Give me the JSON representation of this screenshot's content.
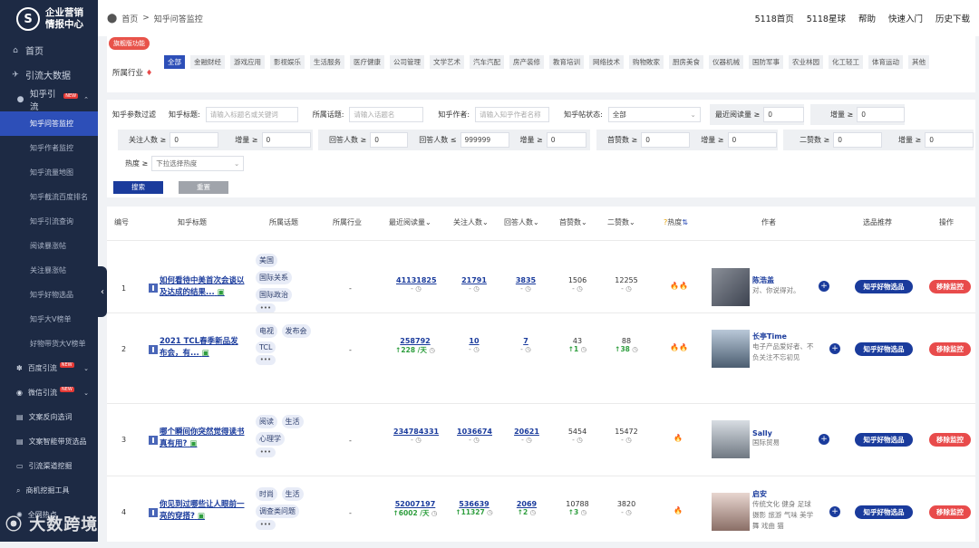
{
  "logo": {
    "line1": "企业营销",
    "line2": "情报中心"
  },
  "sidebar": {
    "top_items": [
      {
        "label": "首页"
      },
      {
        "label": "引流大数据"
      }
    ],
    "zhihu": {
      "label": "知乎引流",
      "badge": "NEW"
    },
    "zhihu_sub": [
      {
        "label": "知乎问答监控",
        "active": true
      },
      {
        "label": "知乎作者监控"
      },
      {
        "label": "知乎流量地图"
      },
      {
        "label": "知乎截流百度排名"
      },
      {
        "label": "知乎引流查询"
      },
      {
        "label": "阅读暴涨帖"
      },
      {
        "label": "关注暴涨帖"
      },
      {
        "label": "知乎好物选品"
      },
      {
        "label": "知乎大V榜单"
      },
      {
        "label": "好物带货大V榜单"
      }
    ],
    "others": [
      {
        "label": "百度引流",
        "badge": "NEW"
      },
      {
        "label": "微信引流",
        "badge": "NEW"
      },
      {
        "label": "文案反向选词"
      },
      {
        "label": "文案智能带货选品"
      },
      {
        "label": "引流渠道挖掘"
      },
      {
        "label": "商机挖掘工具"
      },
      {
        "label": "全网热点"
      }
    ]
  },
  "breadcrumb": {
    "home": "首页",
    "sep": ">",
    "current": "知乎问答监控"
  },
  "toplinks": [
    "5118首页",
    "5118星球",
    "帮助",
    "快速入门",
    "历史下载"
  ],
  "industry": {
    "flag": "旗舰版功能",
    "label": "所属行业",
    "tags": [
      "全部",
      "金融财经",
      "游戏应用",
      "影视娱乐",
      "生活服务",
      "医疗健康",
      "公司管理",
      "文学艺术",
      "汽车汽配",
      "房产装修",
      "教育培训",
      "网络技术",
      "购物敗家",
      "厨房美食",
      "仪器机械",
      "国防军事",
      "农业林园",
      "化工轻工",
      "体育运动",
      "其他"
    ]
  },
  "filters": {
    "section_label": "知乎参数过滤",
    "title_label": "知乎标题:",
    "title_ph": "请输入标题名或关键词",
    "topic_label": "所属话题:",
    "topic_ph": "请输入话题名",
    "author_label": "知乎作者:",
    "author_ph": "请输入知乎作者名称",
    "status_label": "知乎帖状态:",
    "status_val": "全部",
    "read_label": "最近阅读量 ≥",
    "read_val": "0",
    "inc_label": "增量 ≥",
    "inc_val": "0",
    "follow_label": "关注人数 ≥",
    "follow_val": "0",
    "answer_label": "回答人数 ≥",
    "answer_val": "0",
    "answer_max_label": "回答人数 ≤",
    "answer_max_val": "999999",
    "upvote_label": "首赞数 ≥",
    "upvote_val": "0",
    "second_label": "二赞数 ≥",
    "second_val": "0",
    "heat_label": "热度 ≥",
    "heat_ph": "下拉选择热度",
    "search_btn": "搜索",
    "reset_btn": "重置"
  },
  "table": {
    "headers": {
      "no": "编号",
      "title": "知乎标题",
      "topic": "所属话题",
      "industry": "所属行业",
      "read": "最近阅读量",
      "follow": "关注人数",
      "answer": "回答人数",
      "first": "首赞数",
      "second": "二赞数",
      "heat": "热度",
      "author": "作者",
      "rec": "选品推荐",
      "op": "操作"
    },
    "rec_btn": "知乎好物选品",
    "op_btn": "移除监控",
    "rows": [
      {
        "no": "1",
        "title": "如何看待中美首次会谈以及达成的结果...",
        "topics": [
          "美国",
          "国际关系",
          "国际政治"
        ],
        "industry": "-",
        "read": "41131825",
        "read_inc": "-",
        "follow": "21791",
        "follow_inc": "-",
        "answer": "3835",
        "answer_inc": "-",
        "first": "1506",
        "first_inc": "-",
        "second": "12255",
        "second_inc": "-",
        "heat": "🔥🔥",
        "author": "陈浩盖",
        "desc": "对、你说得对。"
      },
      {
        "no": "2",
        "title": "2021 TCL春季新品发布会，有...",
        "topics": [
          "电视",
          "发布会",
          "TCL"
        ],
        "industry": "-",
        "read": "258792",
        "read_inc": "↑228 /天",
        "follow": "10",
        "follow_inc": "-",
        "answer": "7",
        "answer_inc": "-",
        "first": "43",
        "first_inc": "↑1",
        "second": "88",
        "second_inc": "↑38",
        "heat": "🔥🔥",
        "author": "长亭Time",
        "desc": "电子产品爱好者、不负关注不忘初见"
      },
      {
        "no": "3",
        "title": "哪个瞬间你突然觉得读书真有用?",
        "topics": [
          "阅读",
          "生活",
          "心理学"
        ],
        "industry": "-",
        "read": "234784331",
        "read_inc": "-",
        "follow": "1036674",
        "follow_inc": "-",
        "answer": "20621",
        "answer_inc": "-",
        "first": "5454",
        "first_inc": "-",
        "second": "15472",
        "second_inc": "-",
        "heat": "🔥",
        "author": "Sally",
        "desc": "国际贸易"
      },
      {
        "no": "4",
        "title": "你见到过哪些让人眼前一亮的穿搭?",
        "topics": [
          "时尚",
          "生活",
          "调查类问题"
        ],
        "industry": "-",
        "read": "52007197",
        "read_inc": "↑6002 /天",
        "follow": "536639",
        "follow_inc": "↑11327",
        "answer": "2069",
        "answer_inc": "↑2",
        "first": "10788",
        "first_inc": "↑3",
        "second": "3820",
        "second_inc": "-",
        "heat": "🔥",
        "author": "启安",
        "desc": "传统文化 健身 足球 摄影 旅游 气味 美学 舞 戏曲 猫"
      }
    ]
  },
  "watermark": "大数跨境"
}
